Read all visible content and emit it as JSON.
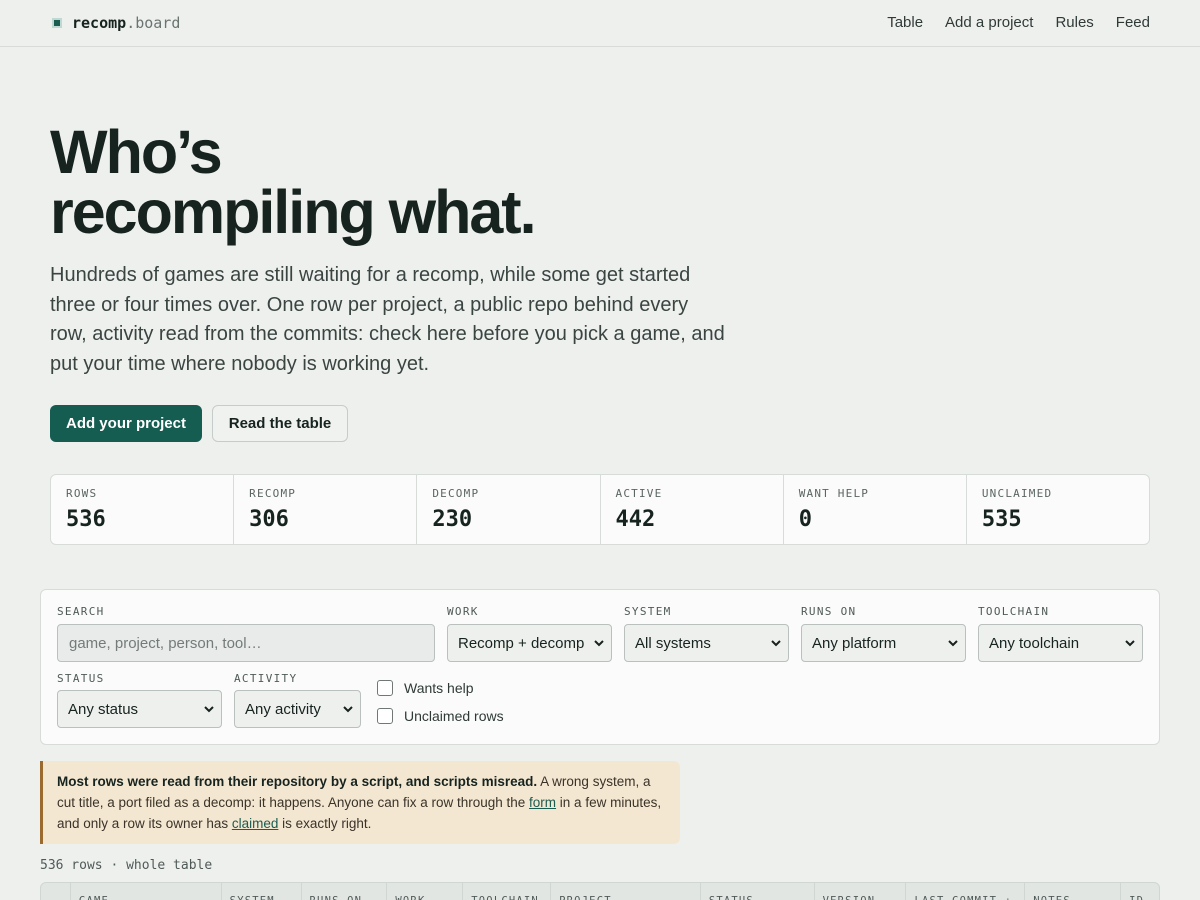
{
  "brand": {
    "name_main": "recomp",
    "name_suffix": ".board"
  },
  "nav": {
    "links": [
      "Table",
      "Add a project",
      "Rules",
      "Feed"
    ]
  },
  "hero": {
    "title_line1": "Who’s",
    "title_line2": "recompiling what.",
    "text": "Hundreds of games are still waiting for a recomp, while some get started three or four times over. One row per project, a public repo behind every row, activity read from the commits: check here before you pick a game, and put your time where nobody is working yet.",
    "primary_button": "Add your project",
    "secondary_button": "Read the table"
  },
  "stats": [
    {
      "label": "ROWS",
      "value": "536"
    },
    {
      "label": "RECOMP",
      "value": "306"
    },
    {
      "label": "DECOMP",
      "value": "230"
    },
    {
      "label": "ACTIVE",
      "value": "442"
    },
    {
      "label": "WANT HELP",
      "value": "0"
    },
    {
      "label": "UNCLAIMED",
      "value": "535"
    }
  ],
  "filters": {
    "search_label": "SEARCH",
    "search_placeholder": "game, project, person, tool…",
    "work_label": "WORK",
    "work_value": "Recomp + decomp",
    "system_label": "SYSTEM",
    "system_value": "All systems",
    "runs_on_label": "RUNS ON",
    "runs_on_value": "Any platform",
    "toolchain_label": "TOOLCHAIN",
    "toolchain_value": "Any toolchain",
    "status_label": "STATUS",
    "status_value": "Any status",
    "activity_label": "ACTIVITY",
    "activity_value": "Any activity",
    "wants_help_label": "Wants help",
    "unclaimed_label": "Unclaimed rows"
  },
  "notice": {
    "bold": "Most rows were read from their repository by a script, and scripts misread.",
    "text_1": " A wrong system, a cut title, a port filed as a decomp: it happens. Anyone can fix a row through the ",
    "link_form": "form",
    "text_2": " in a few minutes, and only a row its owner has ",
    "link_claimed": "claimed",
    "text_3": " is exactly right."
  },
  "table": {
    "row_count": "536 rows · whole table",
    "columns": [
      "",
      "GAME",
      "SYSTEM",
      "RUNS ON",
      "WORK",
      "TOOLCHAIN",
      "PROJECT",
      "STATUS",
      "VERSION",
      "LAST COMMIT ↓",
      "NOTES",
      "ID"
    ]
  }
}
